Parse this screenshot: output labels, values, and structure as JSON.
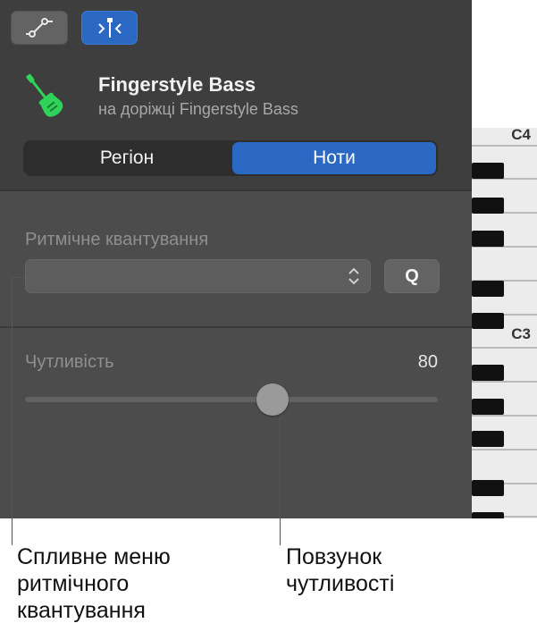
{
  "toolbar": {
    "automation_icon": "automation-curve-icon",
    "flex_icon": "flex-pitch-icon",
    "flex_active_color": "#2a68c3"
  },
  "track": {
    "name": "Fingerstyle Bass",
    "subtitle": "на доріжці Fingerstyle Bass",
    "icon": "bass-guitar-icon",
    "icon_color": "#2fd35a"
  },
  "segmented": {
    "region_label": "Регіон",
    "notes_label": "Ноти",
    "selected": "Ноти"
  },
  "quantize": {
    "label": "Ритмічне квантування",
    "value": "",
    "q_button": "Q"
  },
  "sensitivity": {
    "label": "Чутливість",
    "value": "80",
    "level": 0.6
  },
  "keyboard": {
    "c4_label": "C4",
    "c3_label": "C3"
  },
  "callouts": {
    "quantize_line1": "Спливне меню",
    "quantize_line2": "ритмічного",
    "quantize_line3": "квантування",
    "sensitivity_line1": "Повзунок",
    "sensitivity_line2": "чутливості"
  }
}
